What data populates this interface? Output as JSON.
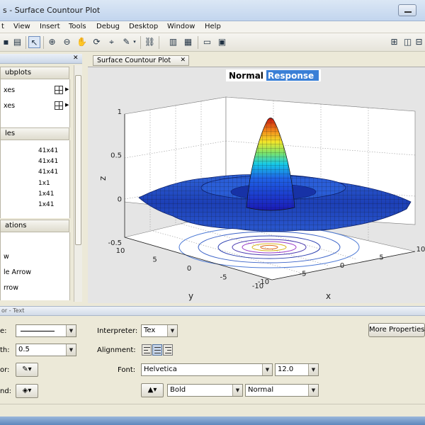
{
  "window": {
    "title": "s - Surface Countour Plot"
  },
  "menu": {
    "items": [
      "t",
      "View",
      "Insert",
      "Tools",
      "Debug",
      "Desktop",
      "Window",
      "Help"
    ]
  },
  "palette": {
    "subplots_header": "ubplots",
    "subplots_rows": [
      "xes",
      "xes"
    ],
    "variables_header": "les",
    "variables_values": [
      "41x41",
      "41x41",
      "41x41",
      "1x1",
      "1x41",
      "1x41"
    ],
    "annotations_header": "ations",
    "annotations_rows": [
      "w",
      "le Arrow",
      "rrow"
    ]
  },
  "figure": {
    "tab_label": "Surface Countour Plot",
    "title_part1": "Normal",
    "title_part2": "Response"
  },
  "chart_data": {
    "type": "surface",
    "title": "Normal Response",
    "xlabel": "x",
    "ylabel": "y",
    "zlabel": "z",
    "x_ticks": [
      "-10",
      "-5",
      "0",
      "5",
      "10"
    ],
    "y_ticks": [
      "10",
      "5",
      "0",
      "-5",
      "-10"
    ],
    "z_ticks": [
      "1",
      "0.5",
      "0",
      "-0.5"
    ],
    "xlim": [
      -10,
      10
    ],
    "ylim": [
      -10,
      10
    ],
    "zlim": [
      -0.5,
      1
    ],
    "grid": true,
    "colormap": "jet",
    "contour_below": true
  },
  "property_editor": {
    "bar_label": "or - Text",
    "linestyle_label": "e:",
    "linewidth_label": "th:",
    "linewidth_value": "0.5",
    "edgecolor_label": "or:",
    "bgcolor_label": "nd:",
    "interpreter_label": "Interpreter:",
    "interpreter_value": "Tex",
    "alignment_label": "Alignment:",
    "font_label": "Font:",
    "font_value": "Helvetica",
    "fontsize_value": "12.0",
    "weight_value": "Bold",
    "angle_value": "Normal",
    "more_button": "More Properties"
  }
}
